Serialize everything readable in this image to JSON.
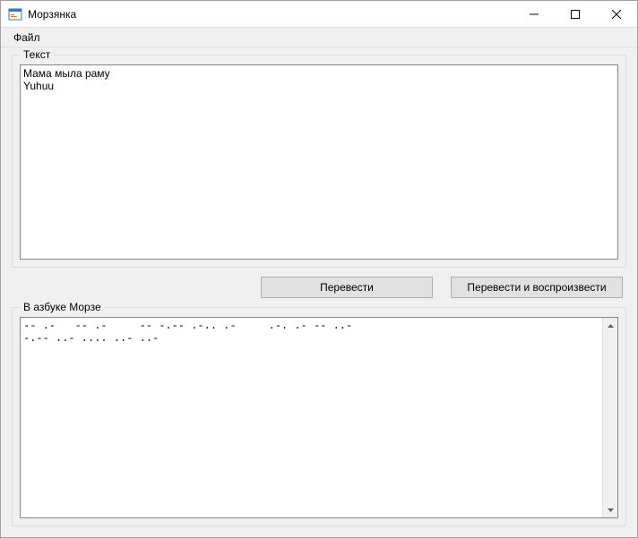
{
  "window": {
    "title": "Морзянка"
  },
  "menu": {
    "file": "Файл"
  },
  "groups": {
    "text_label": "Текст",
    "morse_label": "В азбуке Морзе"
  },
  "input": {
    "text": "Мама мыла раму\nYuhuu"
  },
  "buttons": {
    "translate": "Перевести",
    "translate_play": "Перевести и воспроизвести"
  },
  "output": {
    "morse": "-- .-   -- .-     -- -.-- .-.. .-     .-. .- -- ..-   \n-.-- ..- .... ..- ..-   "
  }
}
